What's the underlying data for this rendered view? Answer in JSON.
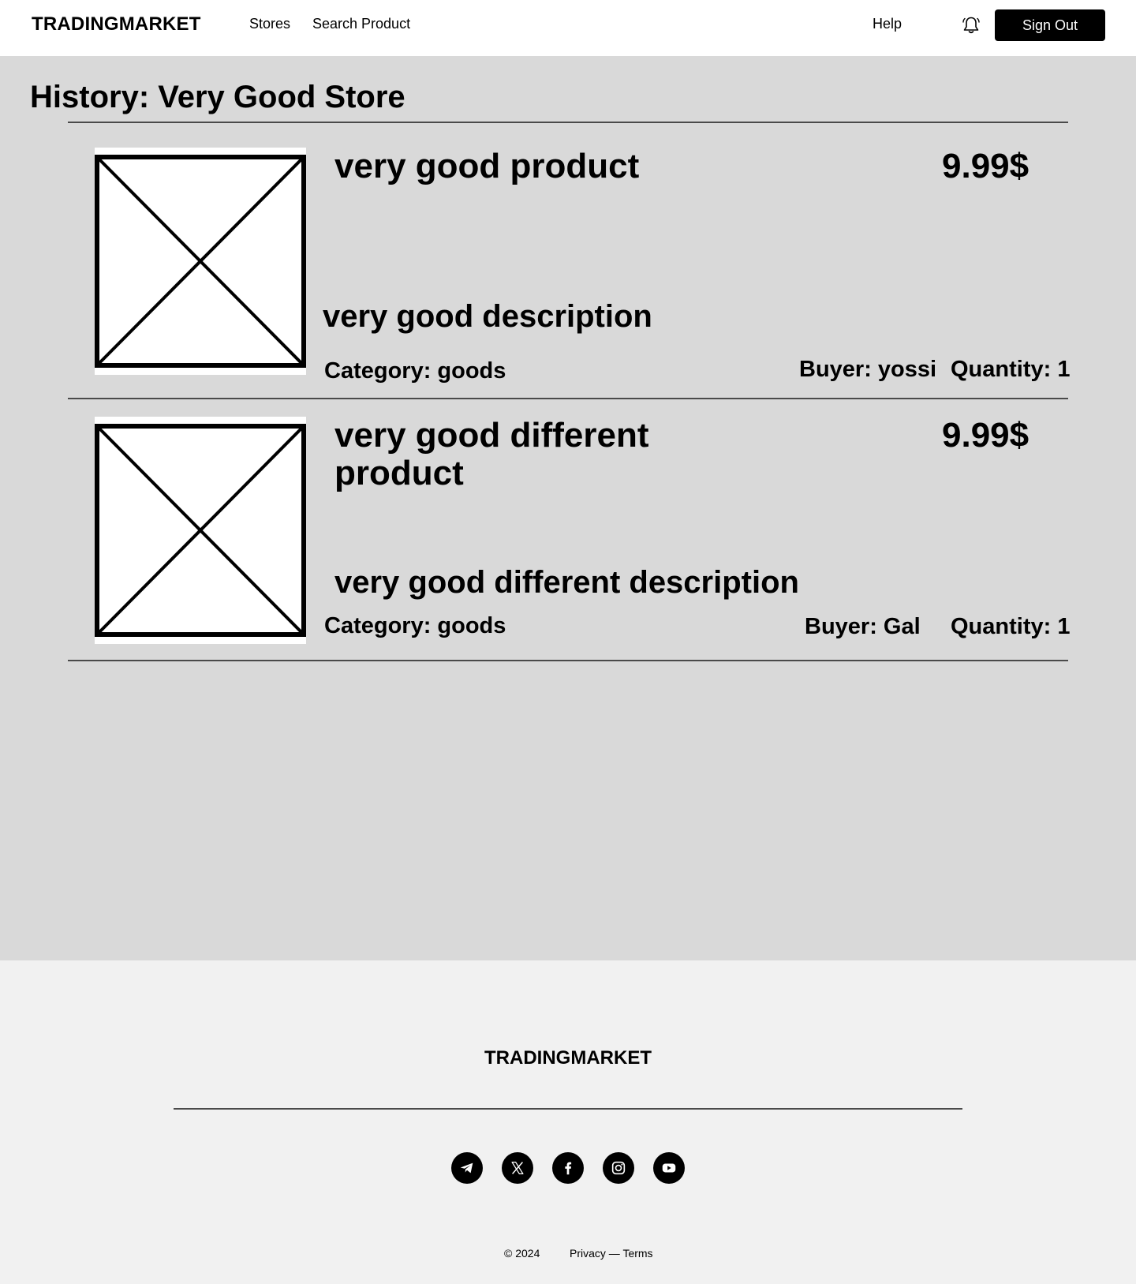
{
  "nav": {
    "logo": "TRADINGMARKET",
    "links": [
      "Stores",
      "Search Product"
    ],
    "help": "Help",
    "notifications_icon": "bell-icon",
    "sign_out": "Sign Out"
  },
  "page": {
    "title": "History: Very Good Store"
  },
  "history": [
    {
      "name": "very good product",
      "price": "9.99$",
      "description": "very good description",
      "category": "Category: goods",
      "buyer": "Buyer: yossi",
      "quantity": "Quantity: 1",
      "image_icon": "image-placeholder-icon"
    },
    {
      "name": "very good different product",
      "price": "9.99$",
      "description": "very good different description",
      "category": "Category: goods",
      "buyer": "Buyer: Gal",
      "quantity": "Quantity: 1",
      "image_icon": "image-placeholder-icon"
    }
  ],
  "footer": {
    "logo": "TRADINGMARKET",
    "socials": [
      "telegram-icon",
      "x-icon",
      "facebook-icon",
      "instagram-icon",
      "youtube-icon"
    ],
    "copyright": "© 2024",
    "privacy": "Privacy",
    "separator": "—",
    "terms": "Terms"
  },
  "colors": {
    "nav_bg": "#ffffff",
    "main_bg": "#d9d9d9",
    "footer_bg": "#f1f1f1",
    "button_bg": "#000000",
    "button_text": "#ffffff"
  }
}
